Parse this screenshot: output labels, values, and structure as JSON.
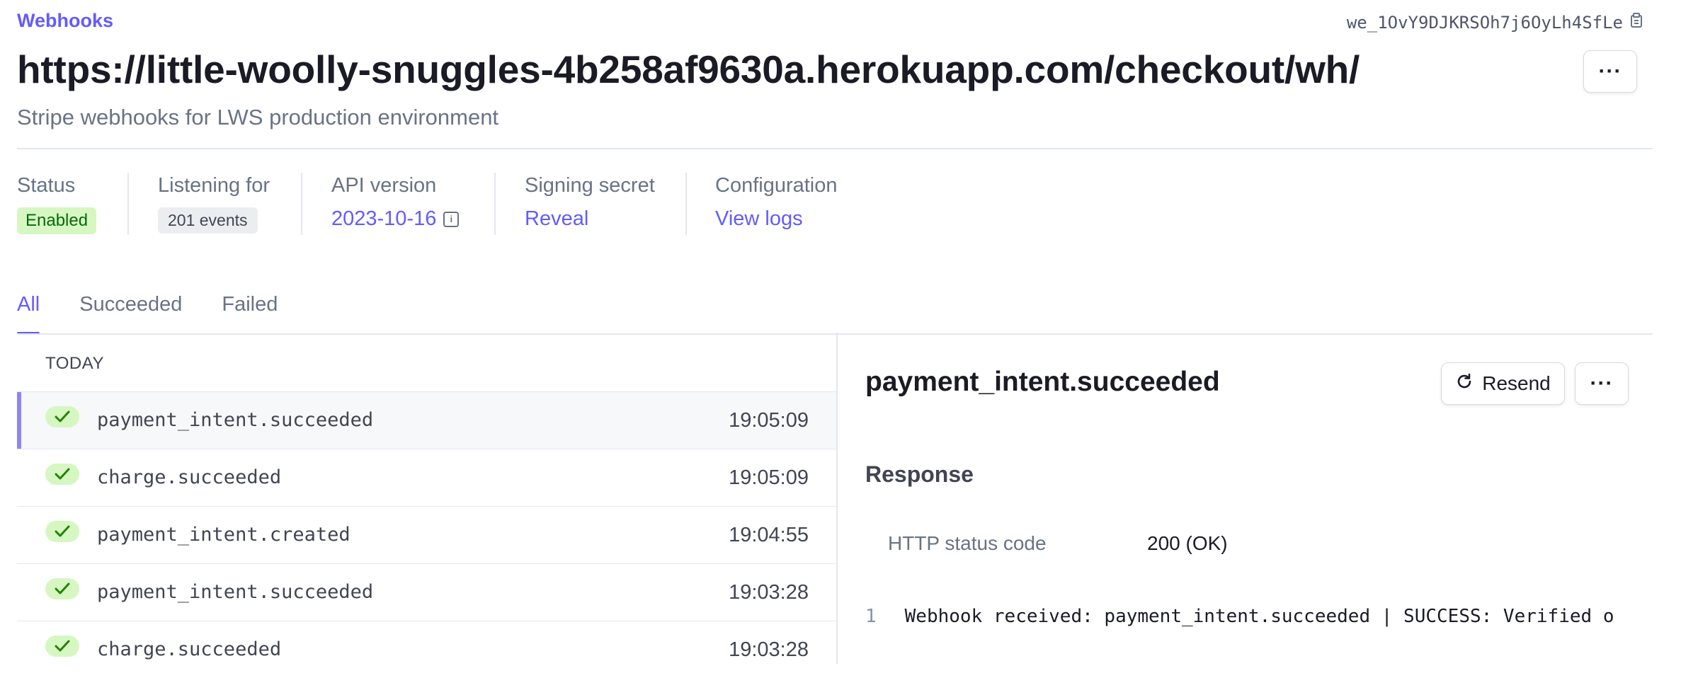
{
  "header": {
    "breadcrumb": "Webhooks",
    "endpoint_id": "we_1OvY9DJKRSOh7j6OyLh4SfLe",
    "title": "https://little-woolly-snuggles-4b258af9630a.herokuapp.com/checkout/wh/",
    "subtitle": "Stripe webhooks for LWS production environment",
    "more_label": "···"
  },
  "meta": {
    "status": {
      "label": "Status",
      "value": "Enabled"
    },
    "listening": {
      "label": "Listening for",
      "value": "201 events"
    },
    "api_version": {
      "label": "API version",
      "value": "2023-10-16",
      "icon": "info-icon"
    },
    "signing_secret": {
      "label": "Signing secret",
      "value": "Reveal"
    },
    "configuration": {
      "label": "Configuration",
      "value": "View logs"
    }
  },
  "tabs": [
    {
      "label": "All",
      "active": true
    },
    {
      "label": "Succeeded",
      "active": false
    },
    {
      "label": "Failed",
      "active": false
    }
  ],
  "events": {
    "group_label": "TODAY",
    "items": [
      {
        "name": "payment_intent.succeeded",
        "time": "19:05:09",
        "status": "succeeded",
        "selected": true
      },
      {
        "name": "charge.succeeded",
        "time": "19:05:09",
        "status": "succeeded",
        "selected": false
      },
      {
        "name": "payment_intent.created",
        "time": "19:04:55",
        "status": "succeeded",
        "selected": false
      },
      {
        "name": "payment_intent.succeeded",
        "time": "19:03:28",
        "status": "succeeded",
        "selected": false
      },
      {
        "name": "charge.succeeded",
        "time": "19:03:28",
        "status": "succeeded",
        "selected": false
      }
    ]
  },
  "detail": {
    "title": "payment_intent.succeeded",
    "resend_label": "Resend",
    "more_label": "···",
    "response_title": "Response",
    "http_status_label": "HTTP status code",
    "http_status_value": "200 (OK)",
    "body_line_number": "1",
    "body_text": "Webhook received: payment_intent.succeeded | SUCCESS: Verified o"
  },
  "colors": {
    "accent": "#635bff",
    "success_bg": "#d7f7c2",
    "success_fg": "#05690d",
    "border": "#e3e8ee",
    "muted_text": "#687385"
  }
}
